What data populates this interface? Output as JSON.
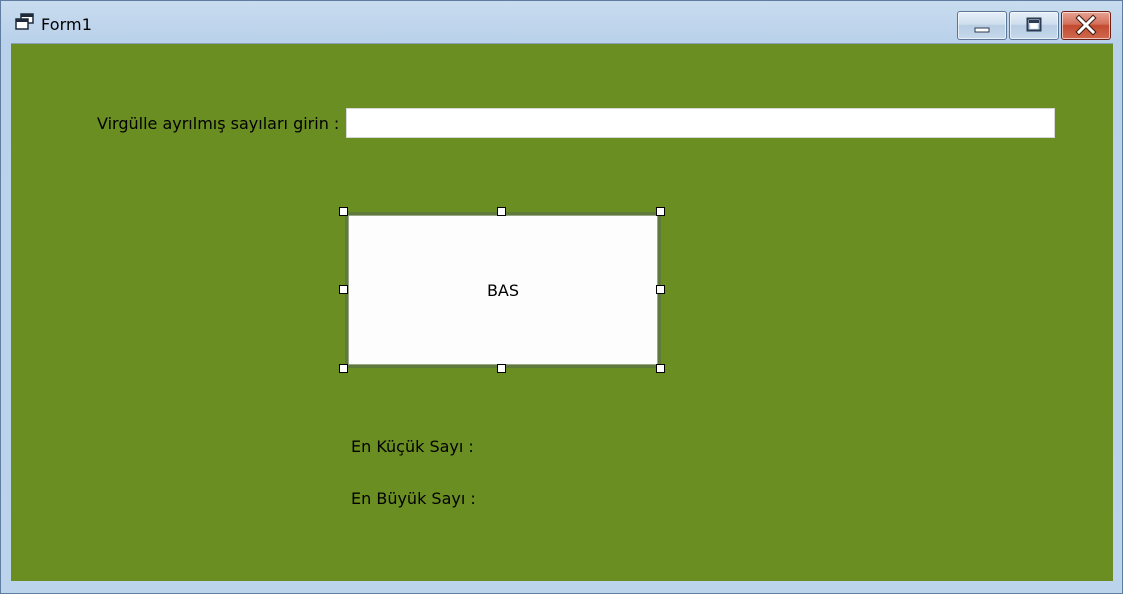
{
  "window": {
    "title": "Form1",
    "controls": {
      "minimize": "minimize-icon",
      "maximize": "maximize-icon",
      "close": "close-icon"
    }
  },
  "form": {
    "background_color": "#6b8e23",
    "prompt_label": "Virgülle ayrılmış sayıları girin :",
    "numbers_input": {
      "value": "",
      "placeholder": ""
    },
    "button_label": "BAS",
    "min_label": "En Küçük Sayı :",
    "max_label": "En Büyük Sayı :"
  }
}
